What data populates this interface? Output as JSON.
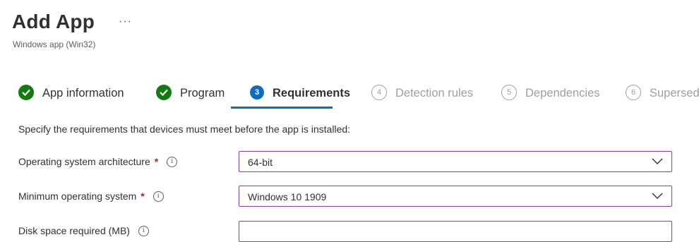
{
  "header": {
    "title": "Add App",
    "subtitle": "Windows app (Win32)",
    "more_label": "···"
  },
  "steps": [
    {
      "label": "App information",
      "state": "done"
    },
    {
      "label": "Program",
      "state": "done"
    },
    {
      "label": "Requirements",
      "state": "active",
      "number": "3"
    },
    {
      "label": "Detection rules",
      "state": "todo",
      "number": "4"
    },
    {
      "label": "Dependencies",
      "state": "todo",
      "number": "5"
    },
    {
      "label": "Supersed",
      "state": "todo",
      "number": "6"
    }
  ],
  "form": {
    "instruction": "Specify the requirements that devices must meet before the app is installed:",
    "fields": [
      {
        "label": "Operating system architecture",
        "required_mark": "*",
        "info_icon": "i",
        "value": "64-bit",
        "type": "dropdown"
      },
      {
        "label": "Minimum operating system",
        "required_mark": "*",
        "info_icon": "i",
        "value": "Windows 10 1909",
        "type": "dropdown"
      },
      {
        "label": "Disk space required (MB)",
        "info_icon": "i",
        "value": "",
        "type": "text"
      }
    ]
  },
  "colors": {
    "done": "#107c10",
    "active": "#0f6cbd",
    "todo": "#a19f9d",
    "focus_border": "#8a3d9a",
    "required": "#a4262c"
  }
}
